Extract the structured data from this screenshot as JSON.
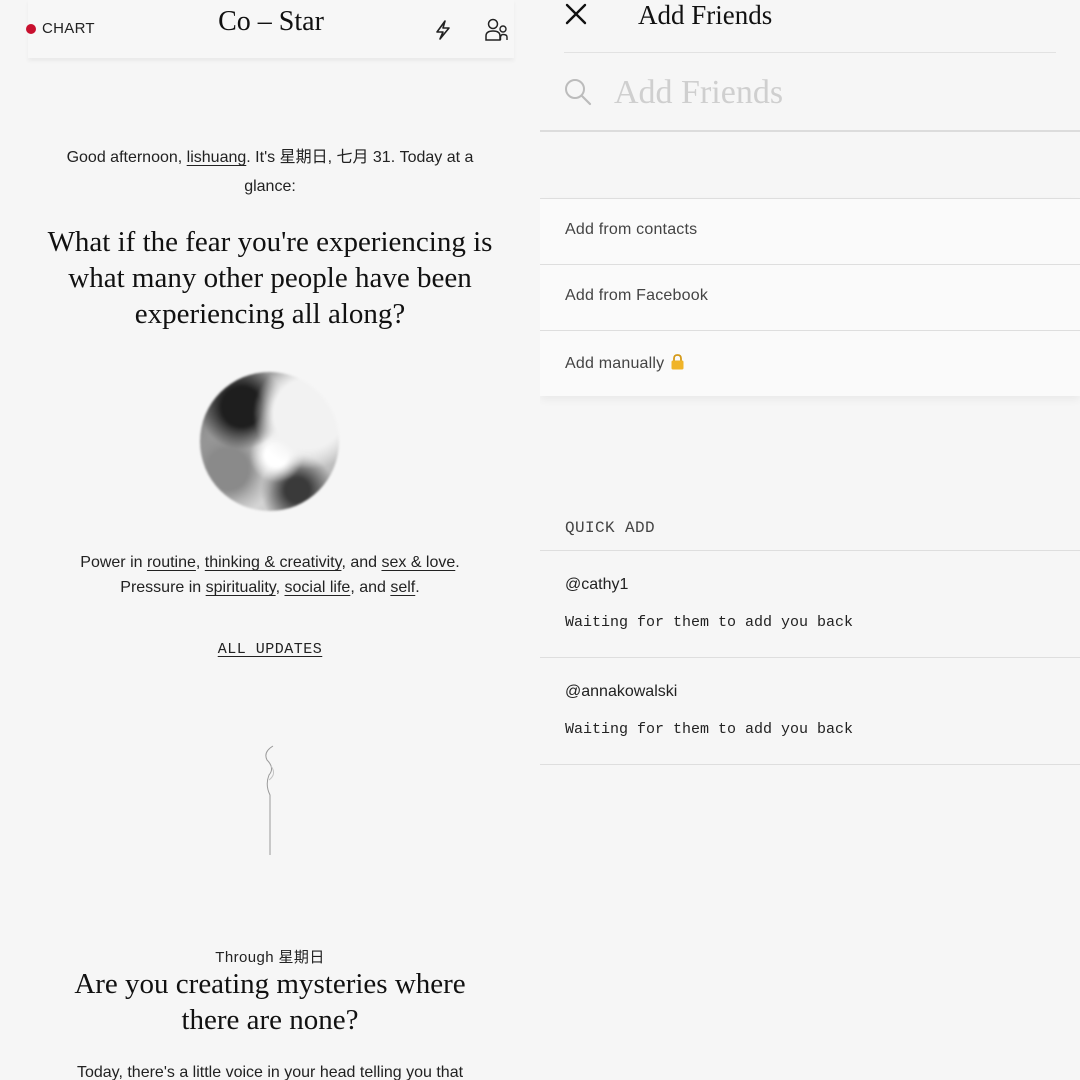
{
  "left": {
    "header": {
      "chart_label": "CHART",
      "brand": "Co – Star",
      "icons": [
        "lightning-icon",
        "friends-icon"
      ]
    },
    "greeting": {
      "prefix": "Good afternoon, ",
      "username": "lishuang",
      "suffix": ". It's 星期日, 七月 31. Today at a glance:"
    },
    "headline": "What if the fear you're experiencing is what many other people have been experiencing all along?",
    "power": {
      "power_prefix": "Power in ",
      "power_1": "routine",
      "sep_1": ", ",
      "power_2": "thinking & creativity",
      "sep_2": ", and ",
      "power_3": "sex & love",
      "end_1": ".",
      "pressure_prefix": "Pressure in ",
      "pressure_1": "spirituality",
      "sep_3": ", ",
      "pressure_2": "social life",
      "sep_4": ", and ",
      "pressure_3": "self",
      "end_2": "."
    },
    "all_updates": "ALL UPDATES",
    "through": "Through  星期日",
    "question": "Are you creating mysteries where there are none?",
    "body_cut": "Today, there's a little voice in your head telling you that"
  },
  "right": {
    "title": "Add Friends",
    "search": {
      "placeholder": "Add Friends",
      "value": ""
    },
    "options": [
      {
        "label": "Add from contacts"
      },
      {
        "label": "Add from Facebook"
      },
      {
        "label": "Add manually",
        "icon": "lock-icon"
      }
    ],
    "quick_add_label": "QUICK ADD",
    "quick_add": [
      {
        "handle": "@cathy1",
        "status": "Waiting for them to add you back"
      },
      {
        "handle": "@annakowalski",
        "status": "Waiting for them to add you back"
      }
    ]
  },
  "colors": {
    "accent": "#c8102e",
    "background": "#f6f6f6",
    "lock": "#f0b429"
  }
}
